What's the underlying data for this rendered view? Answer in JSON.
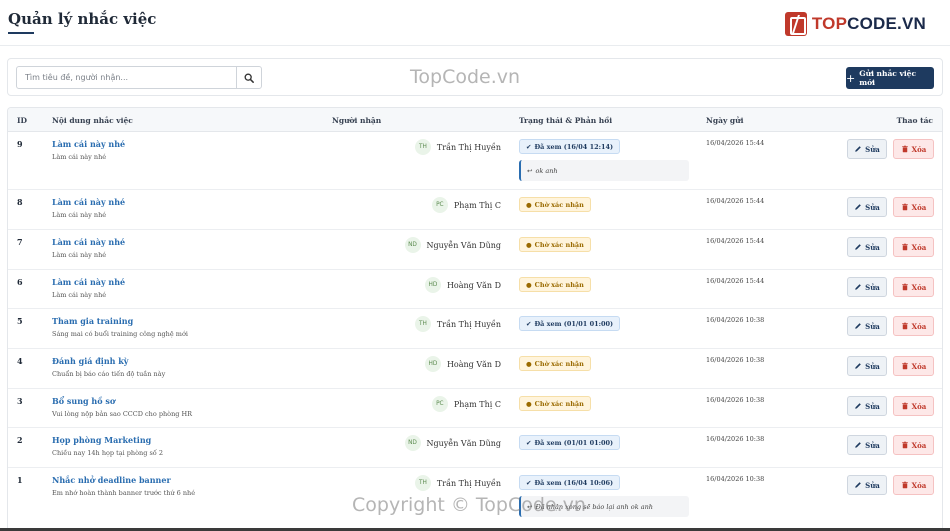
{
  "header": {
    "title": "Quản lý nhắc việc"
  },
  "brand": {
    "name_part1": "TOP",
    "name_part2": "CODE.VN",
    "accent": "#c0392b",
    "dark": "#1b2a4a"
  },
  "toolbar": {
    "search_placeholder": "Tìm tiêu đề, người nhận...",
    "search_icon": "search-icon",
    "send_button_label": "Gửi nhắc việc mới",
    "send_button_color": "#1e3a5f"
  },
  "table": {
    "columns": {
      "id": "ID",
      "content": "Nội dung nhắc việc",
      "recipient": "Người nhận",
      "status": "Trạng thái & Phản hồi",
      "sent": "Ngày gửi",
      "actions": "Thao tác"
    },
    "edit_label": "Sửa",
    "delete_label": "Xóa",
    "rows": [
      {
        "id": "9",
        "title": "Làm cái này nhé",
        "desc": "Làm cái này nhé",
        "initials": "TH",
        "recipient": "Trần Thị Huyền",
        "status": "Đã xem (16/04 12:14)",
        "status_type": "seen",
        "reply": "ok anh",
        "date": "16/04/2026 15:44"
      },
      {
        "id": "8",
        "title": "Làm cái này nhé",
        "desc": "Làm cái này nhé",
        "initials": "PC",
        "recipient": "Phạm Thị C",
        "status": "Chờ xác nhận",
        "status_type": "pending",
        "date": "16/04/2026 15:44"
      },
      {
        "id": "7",
        "title": "Làm cái này nhé",
        "desc": "Làm cái này nhé",
        "initials": "ND",
        "recipient": "Nguyễn Văn Dũng",
        "status": "Chờ xác nhận",
        "status_type": "pending",
        "date": "16/04/2026 15:44"
      },
      {
        "id": "6",
        "title": "Làm cái này nhé",
        "desc": "Làm cái này nhé",
        "initials": "HD",
        "recipient": "Hoàng Văn D",
        "status": "Chờ xác nhận",
        "status_type": "pending",
        "date": "16/04/2026 15:44"
      },
      {
        "id": "5",
        "title": "Tham gia training",
        "desc": "Sáng mai có buổi training công nghệ mới",
        "initials": "TH",
        "recipient": "Trần Thị Huyền",
        "status": "Đã xem (01/01 01:00)",
        "status_type": "seen",
        "date": "16/04/2026 10:38"
      },
      {
        "id": "4",
        "title": "Đánh giá định kỳ",
        "desc": "Chuẩn bị báo cáo tiến độ tuần này",
        "initials": "HD",
        "recipient": "Hoàng Văn D",
        "status": "Chờ xác nhận",
        "status_type": "pending",
        "date": "16/04/2026 10:38"
      },
      {
        "id": "3",
        "title": "Bổ sung hồ sơ",
        "desc": "Vui lòng nộp bản sao CCCD cho phòng HR",
        "initials": "PC",
        "recipient": "Phạm Thị C",
        "status": "Chờ xác nhận",
        "status_type": "pending",
        "date": "16/04/2026 10:38"
      },
      {
        "id": "2",
        "title": "Họp phòng Marketing",
        "desc": "Chiều nay 14h họp tại phòng số 2",
        "initials": "ND",
        "recipient": "Nguyễn Văn Dũng",
        "status": "Đã xem (01/01 01:00)",
        "status_type": "seen",
        "date": "16/04/2026 10:38"
      },
      {
        "id": "1",
        "title": "Nhắc nhở deadline banner",
        "desc": "Em nhớ hoàn thành banner trước thứ 6 nhé",
        "initials": "TH",
        "recipient": "Trần Thị Huyền",
        "status": "Đã xem (16/04 10:06)",
        "status_type": "seen",
        "reply": "Đã nhận xong sẽ báo lại anh ok anh",
        "date": "16/04/2026 10:38"
      }
    ]
  },
  "watermarks": {
    "top": "TopCode.vn",
    "bottom": "Copyright © TopCode.vn"
  }
}
